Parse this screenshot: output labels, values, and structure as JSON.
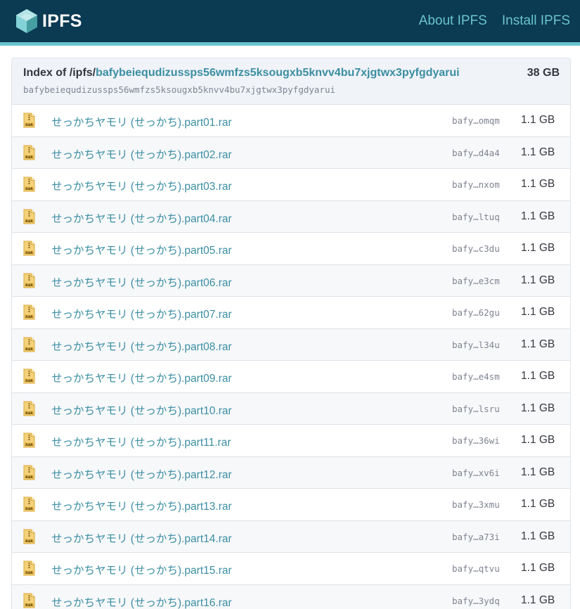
{
  "brand": {
    "name": "IPFS",
    "icon": "ipfs-cube-icon",
    "color": "#69c4cd"
  },
  "nav": [
    {
      "label": "About IPFS"
    },
    {
      "label": "Install IPFS"
    }
  ],
  "colors": {
    "topbar": "#0b3a53",
    "accent": "#69c4cd",
    "link": "#3b8ea3",
    "header_bg": "#f0f3f7"
  },
  "listing": {
    "index_prefix": "Index of /ipfs/",
    "cid": "bafybeiequdizussps56wmfzs5ksougxb5knvv4bu7xjgtwx3pyfgdyarui",
    "total_size": "38 GB",
    "file_icon": "rar-file-icon",
    "files": [
      {
        "name": "せっかちヤモリ (せっかち).part01.rar",
        "cid": "bafy…omqm",
        "size": "1.1 GB"
      },
      {
        "name": "せっかちヤモリ (せっかち).part02.rar",
        "cid": "bafy…d4a4",
        "size": "1.1 GB"
      },
      {
        "name": "せっかちヤモリ (せっかち).part03.rar",
        "cid": "bafy…nxom",
        "size": "1.1 GB"
      },
      {
        "name": "せっかちヤモリ (せっかち).part04.rar",
        "cid": "bafy…ltuq",
        "size": "1.1 GB"
      },
      {
        "name": "せっかちヤモリ (せっかち).part05.rar",
        "cid": "bafy…c3du",
        "size": "1.1 GB"
      },
      {
        "name": "せっかちヤモリ (せっかち).part06.rar",
        "cid": "bafy…e3cm",
        "size": "1.1 GB"
      },
      {
        "name": "せっかちヤモリ (せっかち).part07.rar",
        "cid": "bafy…62gu",
        "size": "1.1 GB"
      },
      {
        "name": "せっかちヤモリ (せっかち).part08.rar",
        "cid": "bafy…l34u",
        "size": "1.1 GB"
      },
      {
        "name": "せっかちヤモリ (せっかち).part09.rar",
        "cid": "bafy…e4sm",
        "size": "1.1 GB"
      },
      {
        "name": "せっかちヤモリ (せっかち).part10.rar",
        "cid": "bafy…lsru",
        "size": "1.1 GB"
      },
      {
        "name": "せっかちヤモリ (せっかち).part11.rar",
        "cid": "bafy…36wi",
        "size": "1.1 GB"
      },
      {
        "name": "せっかちヤモリ (せっかち).part12.rar",
        "cid": "bafy…xv6i",
        "size": "1.1 GB"
      },
      {
        "name": "せっかちヤモリ (せっかち).part13.rar",
        "cid": "bafy…3xmu",
        "size": "1.1 GB"
      },
      {
        "name": "せっかちヤモリ (せっかち).part14.rar",
        "cid": "bafy…a73i",
        "size": "1.1 GB"
      },
      {
        "name": "せっかちヤモリ (せっかち).part15.rar",
        "cid": "bafy…qtvu",
        "size": "1.1 GB"
      },
      {
        "name": "せっかちヤモリ (せっかち).part16.rar",
        "cid": "bafy…3ydq",
        "size": "1.1 GB"
      }
    ]
  }
}
